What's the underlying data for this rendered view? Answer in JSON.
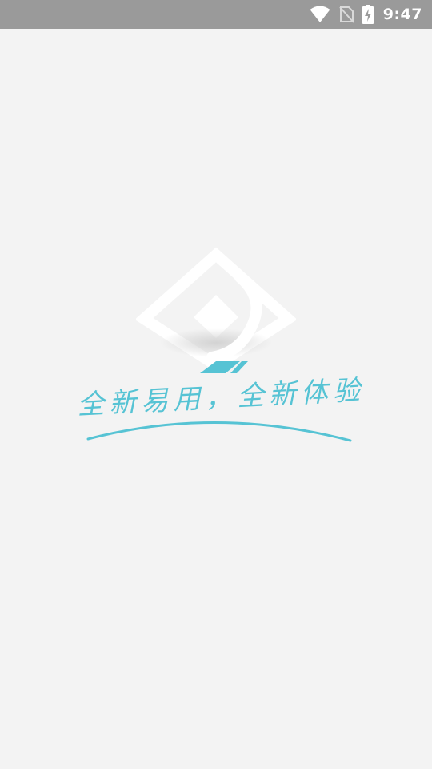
{
  "status_bar": {
    "time": "9:47",
    "icons": [
      "wifi-icon",
      "no-sim-icon",
      "battery-charging-icon"
    ]
  },
  "splash": {
    "logo": "app-logo",
    "slogan": "全新易用，全新体验"
  },
  "colors": {
    "accent": "#56c3d4",
    "background": "#f3f3f3",
    "status_bar": "#9a9a9a"
  }
}
